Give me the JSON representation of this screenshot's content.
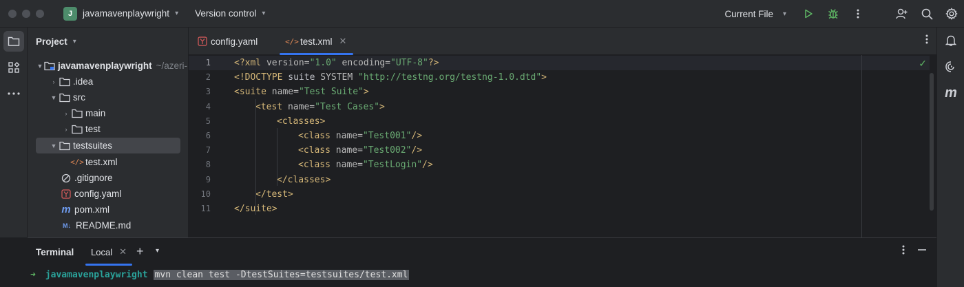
{
  "titlebar": {
    "project_badge": "J",
    "project_name": "javamavenplaywright",
    "vcs_label": "Version control",
    "run_config": "Current File"
  },
  "project_panel": {
    "title": "Project",
    "tree": [
      {
        "label": "javamavenplaywright",
        "hint": "~/azeri-",
        "icon": "module-folder-icon",
        "expanded": true,
        "depth": 0
      },
      {
        "label": ".idea",
        "icon": "folder-icon",
        "expanded": false,
        "depth": 1
      },
      {
        "label": "src",
        "icon": "folder-icon",
        "expanded": true,
        "depth": 1
      },
      {
        "label": "main",
        "icon": "folder-icon",
        "expanded": false,
        "depth": 2
      },
      {
        "label": "test",
        "icon": "folder-icon",
        "expanded": false,
        "depth": 2
      },
      {
        "label": "testsuites",
        "icon": "folder-icon",
        "expanded": true,
        "depth": 1,
        "selected": true
      },
      {
        "label": "test.xml",
        "icon": "xml-file-icon",
        "depth": 2
      },
      {
        "label": ".gitignore",
        "icon": "gitignore-icon",
        "depth": 1
      },
      {
        "label": "config.yaml",
        "icon": "yaml-file-icon",
        "depth": 1
      },
      {
        "label": "pom.xml",
        "icon": "maven-icon",
        "depth": 1
      },
      {
        "label": "README.md",
        "icon": "markdown-icon",
        "depth": 1
      }
    ]
  },
  "editor": {
    "tabs": [
      {
        "label": "config.yaml",
        "icon": "yaml-file-icon",
        "active": false
      },
      {
        "label": "test.xml",
        "icon": "xml-file-icon",
        "active": true
      }
    ],
    "line_numbers": [
      "1",
      "2",
      "3",
      "4",
      "5",
      "6",
      "7",
      "8",
      "9",
      "10",
      "11"
    ],
    "code": [
      {
        "t": "<?xml ",
        "a": "version=",
        "v": "\"1.0\"",
        "a2": " encoding=",
        "v2": "\"UTF-8\"",
        "t2": "?>"
      },
      {
        "t": "<!DOCTYPE ",
        "p": "suite ",
        "a": "SYSTEM ",
        "v": "\"http://testng.org/testng-1.0.dtd\"",
        "t2": ">"
      },
      {
        "t": "<suite ",
        "a": "name=",
        "v": "\"Test Suite\"",
        "t2": ">"
      },
      {
        "t": "<test ",
        "a": "name=",
        "v": "\"Test Cases\"",
        "t2": ">"
      },
      {
        "t": "<classes>"
      },
      {
        "t": "<class ",
        "a": "name=",
        "v": "\"Test001\"",
        "t2": "/>"
      },
      {
        "t": "<class ",
        "a": "name=",
        "v": "\"Test002\"",
        "t2": "/>"
      },
      {
        "t": "<class ",
        "a": "name=",
        "v": "\"TestLogin\"",
        "t2": "/>"
      },
      {
        "t": "</classes>"
      },
      {
        "t": "</test>"
      },
      {
        "t": "</suite>"
      }
    ]
  },
  "terminal": {
    "title": "Terminal",
    "tab_label": "Local",
    "prompt_symbol": "➜",
    "cwd": "javamavenplaywright",
    "command": "mvn clean test -DtestSuites=testsuites/test.xml"
  },
  "colors": {
    "accent": "#3574f0",
    "xml_tag": "#d5b778",
    "xml_value": "#6aab73",
    "prompt_dir": "#2aa39b",
    "success": "#5fb865"
  }
}
